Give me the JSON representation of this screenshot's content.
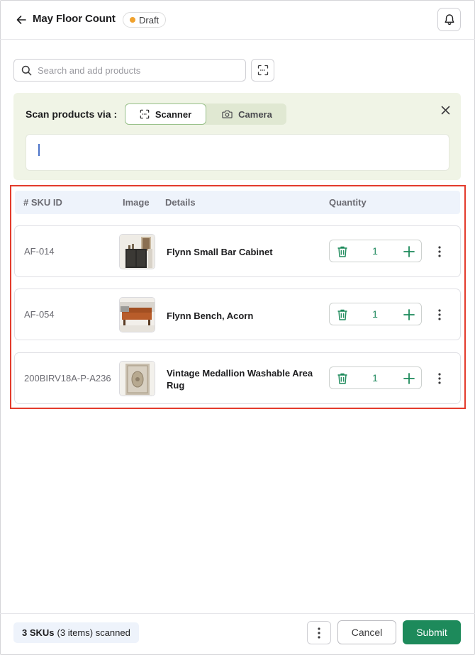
{
  "header": {
    "title": "May Floor Count",
    "status_badge": "Draft",
    "status_color": "#f0a22e"
  },
  "search": {
    "placeholder": "Search and add products",
    "value": ""
  },
  "scan_panel": {
    "label": "Scan products via :",
    "modes": [
      {
        "label": "Scanner",
        "icon": "barcode-scan-icon",
        "selected": true
      },
      {
        "label": "Camera",
        "icon": "camera-icon",
        "selected": false
      }
    ],
    "input_value": ""
  },
  "table": {
    "columns": [
      "# SKU ID",
      "Image",
      "Details",
      "Quantity"
    ],
    "rows": [
      {
        "sku": "AF-014",
        "image": "bar-cabinet-thumbnail",
        "name": "Flynn Small Bar Cabinet",
        "quantity": "1"
      },
      {
        "sku": "AF-054",
        "image": "bench-thumbnail",
        "name": "Flynn Bench, Acorn",
        "quantity": "1"
      },
      {
        "sku": "200BIRV18A-P-A236",
        "image": "rug-thumbnail",
        "name": "Vintage Medallion Washable Area Rug",
        "quantity": "1"
      }
    ]
  },
  "footer": {
    "scanned_count": "3 SKUs",
    "scanned_detail": "(3 items) scanned",
    "cancel_label": "Cancel",
    "submit_label": "Submit"
  },
  "colors": {
    "accent_green": "#1d8a5b",
    "scan_panel_bg": "#f0f4e6",
    "table_head_bg": "#eef3fb",
    "highlight_red": "#e33b2c"
  }
}
